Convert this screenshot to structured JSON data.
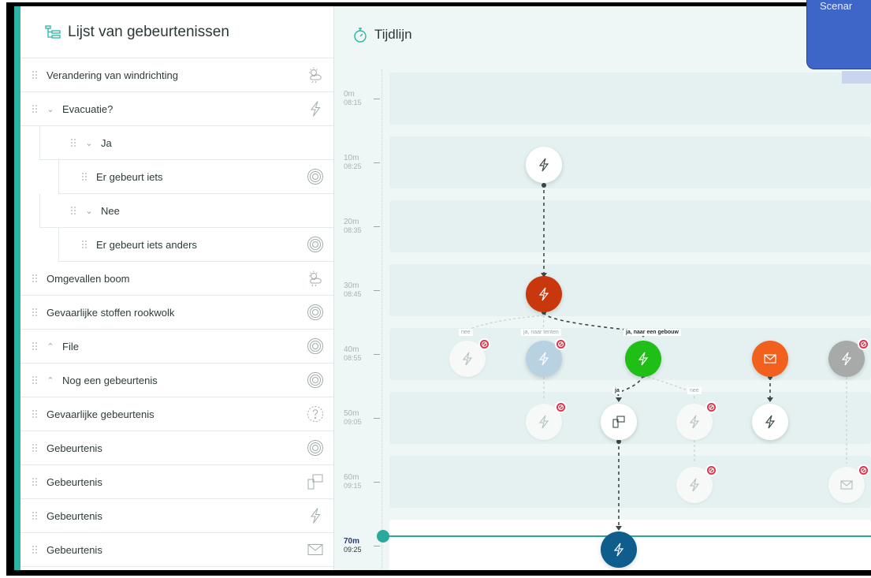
{
  "sidebar": {
    "title": "Lijst van gebeurtenissen",
    "items": [
      {
        "label": "Verandering van windrichting",
        "icon": "weather-icon",
        "level": 0
      },
      {
        "label": "Evacuatie?",
        "icon": "lightning-icon",
        "level": 0,
        "chevron": "down"
      },
      {
        "label": "Ja",
        "icon": "",
        "level": 1,
        "chevron": "down"
      },
      {
        "label": "Er gebeurt iets",
        "icon": "target-icon",
        "level": 2
      },
      {
        "label": "Nee",
        "icon": "",
        "level": 1,
        "chevron": "down"
      },
      {
        "label": "Er gebeurt iets anders",
        "icon": "target-icon",
        "level": 2
      },
      {
        "label": "Omgevallen boom",
        "icon": "weather-icon",
        "level": 0
      },
      {
        "label": "Gevaarlijke stoffen rookwolk",
        "icon": "target-icon",
        "level": 0
      },
      {
        "label": "File",
        "icon": "target-icon",
        "level": 0,
        "chevron": "up"
      },
      {
        "label": "Nog een gebeurtenis",
        "icon": "target-icon",
        "level": 0,
        "chevron": "up"
      },
      {
        "label": "Gevaarlijke gebeurtenis",
        "icon": "question-icon",
        "level": 0
      },
      {
        "label": "Gebeurtenis",
        "icon": "target-icon",
        "level": 0
      },
      {
        "label": "Gebeurtenis",
        "icon": "devices-icon",
        "level": 0
      },
      {
        "label": "Gebeurtenis",
        "icon": "lightning-icon",
        "level": 0
      },
      {
        "label": "Gebeurtenis",
        "icon": "mail-icon",
        "level": 0
      }
    ]
  },
  "timeline": {
    "title": "Tijdlijn",
    "ticks": [
      {
        "minutes": "0m",
        "time": "08:15"
      },
      {
        "minutes": "10m",
        "time": "08:25"
      },
      {
        "minutes": "20m",
        "time": "08:35"
      },
      {
        "minutes": "30m",
        "time": "08:45"
      },
      {
        "minutes": "40m",
        "time": "08:55"
      },
      {
        "minutes": "50m",
        "time": "09:05"
      },
      {
        "minutes": "60m",
        "time": "09:15"
      },
      {
        "minutes": "70m",
        "time": "09:25"
      }
    ],
    "edge_labels": {
      "nee_1": "nee",
      "ja_naar_tenten": "ja, naar tenten",
      "ja_naar_een_gebouw": "ja, naar een gebouw",
      "ja": "ja",
      "nee_2": "nee"
    },
    "colors": {
      "accent": "#2bb3a6",
      "red": "#c8380c",
      "green": "#1fbf18",
      "orange": "#f2601d",
      "blue": "#0f5d8c",
      "badge": "#e0334a"
    }
  },
  "scenario_tab": {
    "label": "Scenar"
  }
}
